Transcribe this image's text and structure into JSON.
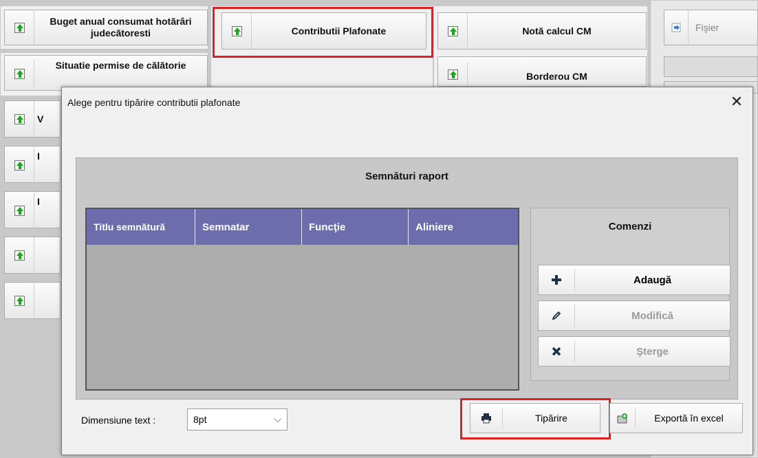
{
  "background": {
    "tiles": [
      {
        "label": "Buget anual consumat hotărâri judecătoresti"
      },
      {
        "label": "Contributii Plafonate"
      },
      {
        "label": "Notă calcul CM"
      },
      {
        "label": "Situatie permise de călătorie"
      },
      {
        "label": "Borderou CM"
      }
    ],
    "right_panel": {
      "label": "Fişier"
    },
    "left_column_fragments": [
      "V",
      "I",
      "I"
    ]
  },
  "dialog": {
    "title": "Alege pentru tipărire contributii plafonate",
    "close_glyph": "✕",
    "panel_title": "Semnături raport",
    "table": {
      "columns": [
        "Titlu semnătură",
        "Semnatar",
        "Funcţie",
        "Aliniere"
      ],
      "rows": []
    },
    "commands": {
      "title": "Comenzi",
      "add_label": "Adaugă",
      "edit_label": "Modifică",
      "delete_label": "Şterge"
    },
    "text_size": {
      "label": "Dimensiune text :",
      "value": "8pt"
    },
    "print_label": "Tipărire",
    "export_label": "Exportă în excel"
  },
  "colors": {
    "header_bg": "#6d6dad",
    "highlight": "#e02020",
    "grid_bg": "#adadad"
  }
}
